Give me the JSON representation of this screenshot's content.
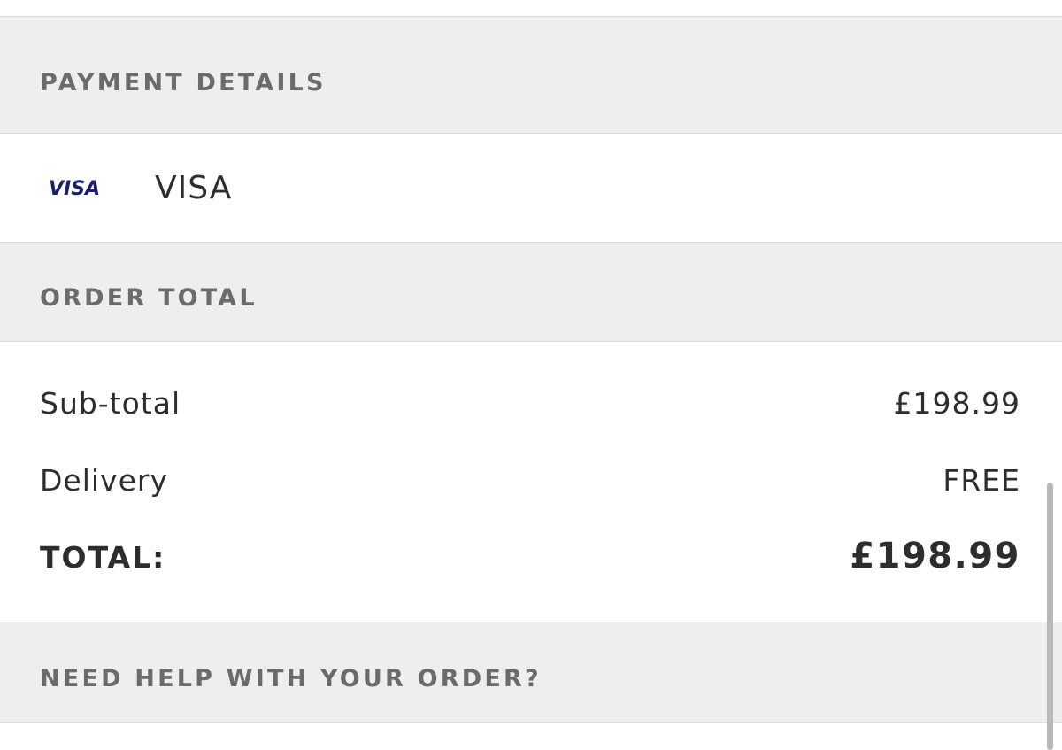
{
  "payment": {
    "header": "PAYMENT DETAILS",
    "card_logo_text": "VISA",
    "card_logo_color": "#1a1f71",
    "method_label": "VISA"
  },
  "order_total": {
    "header": "ORDER TOTAL",
    "rows": [
      {
        "label": "Sub-total",
        "value": "£198.99"
      },
      {
        "label": "Delivery",
        "value": "FREE"
      },
      {
        "label": "TOTAL:",
        "value": "£198.99"
      }
    ]
  },
  "help": {
    "header": "NEED HELP WITH YOUR ORDER?"
  },
  "colors": {
    "section_header_bg": "#eeeeee",
    "section_header_text": "#6b6b6b",
    "body_text": "#2d2d2d",
    "divider": "#dcdcdc"
  }
}
